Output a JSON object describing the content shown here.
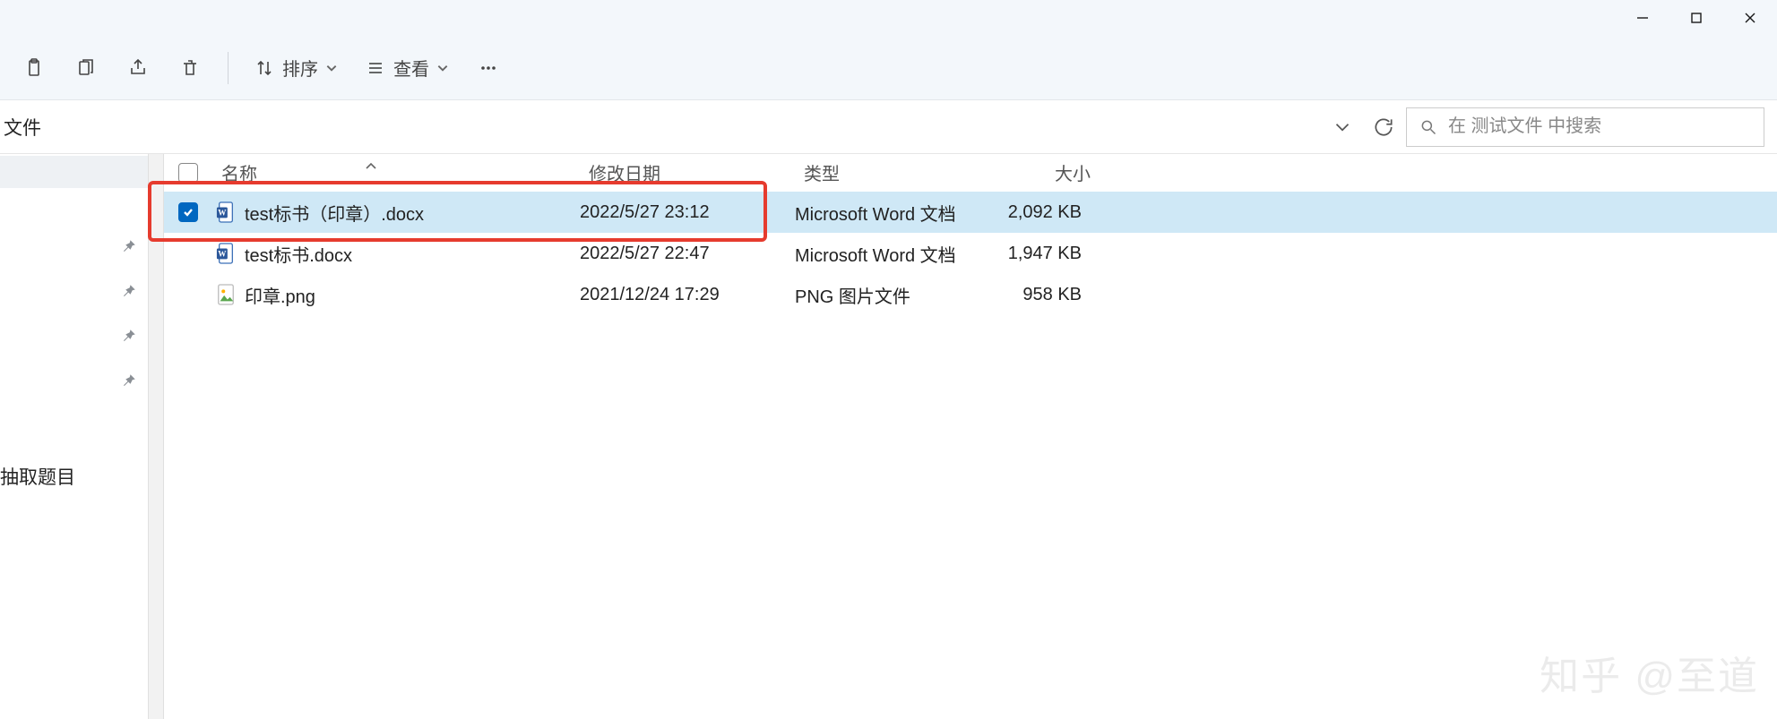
{
  "window": {
    "minimize_tooltip": "Minimize",
    "maximize_tooltip": "Maximize",
    "close_tooltip": "Close"
  },
  "toolbar": {
    "sort_label": "排序",
    "view_label": "查看"
  },
  "address": {
    "title": "文件",
    "search_placeholder": "在 测试文件 中搜索"
  },
  "sidebar": {
    "bottom_label": "抽取题目"
  },
  "columns": {
    "name": "名称",
    "modified": "修改日期",
    "type": "类型",
    "size": "大小"
  },
  "files": [
    {
      "name": "test标书（印章）.docx",
      "modified": "2022/5/27 23:12",
      "type": "Microsoft Word 文档",
      "size": "2,092 KB",
      "icon": "word",
      "selected": true
    },
    {
      "name": "test标书.docx",
      "modified": "2022/5/27 22:47",
      "type": "Microsoft Word 文档",
      "size": "1,947 KB",
      "icon": "word",
      "selected": false
    },
    {
      "name": "印章.png",
      "modified": "2021/12/24 17:29",
      "type": "PNG 图片文件",
      "size": "958 KB",
      "icon": "png",
      "selected": false
    }
  ],
  "watermark": "知乎 @至道"
}
